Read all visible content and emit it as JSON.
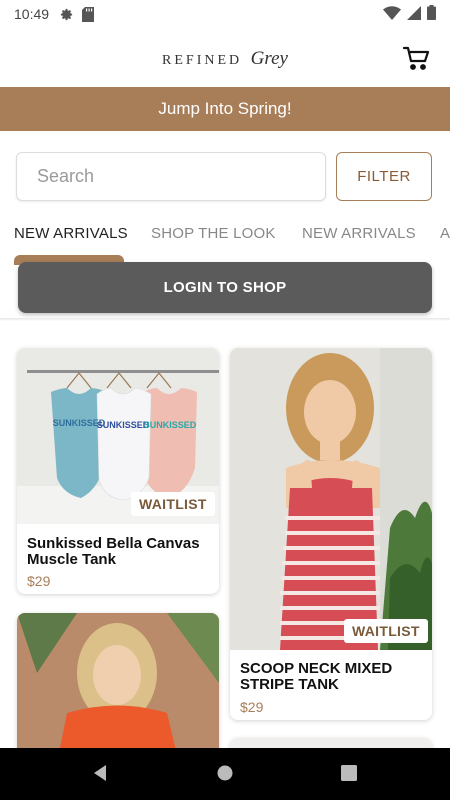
{
  "status_bar": {
    "time": "10:49"
  },
  "header": {
    "logo_main": "REFINED",
    "logo_script": "Grey"
  },
  "banner": {
    "text": "Jump Into Spring!"
  },
  "search": {
    "placeholder": "Search",
    "value": ""
  },
  "filter_label": "FILTER",
  "tabs": [
    {
      "label": "NEW ARRIVALS",
      "active": true
    },
    {
      "label": "SHOP THE LOOK",
      "active": false
    },
    {
      "label": "NEW ARRIVALS",
      "active": false
    },
    {
      "label": "A",
      "active": false
    }
  ],
  "login_label": "LOGIN TO SHOP",
  "products": [
    {
      "name": "Sunkissed Bella Canvas Muscle Tank",
      "price": "$29",
      "badge": "WAITLIST"
    },
    {
      "name": "SCOOP NECK MIXED STRIPE TANK",
      "price": "$29",
      "badge": "WAITLIST"
    }
  ],
  "product_image_text": "SUNKISSED",
  "colors": {
    "accent": "#a77e58",
    "login": "#5b5b5b",
    "price": "#a77e58"
  }
}
